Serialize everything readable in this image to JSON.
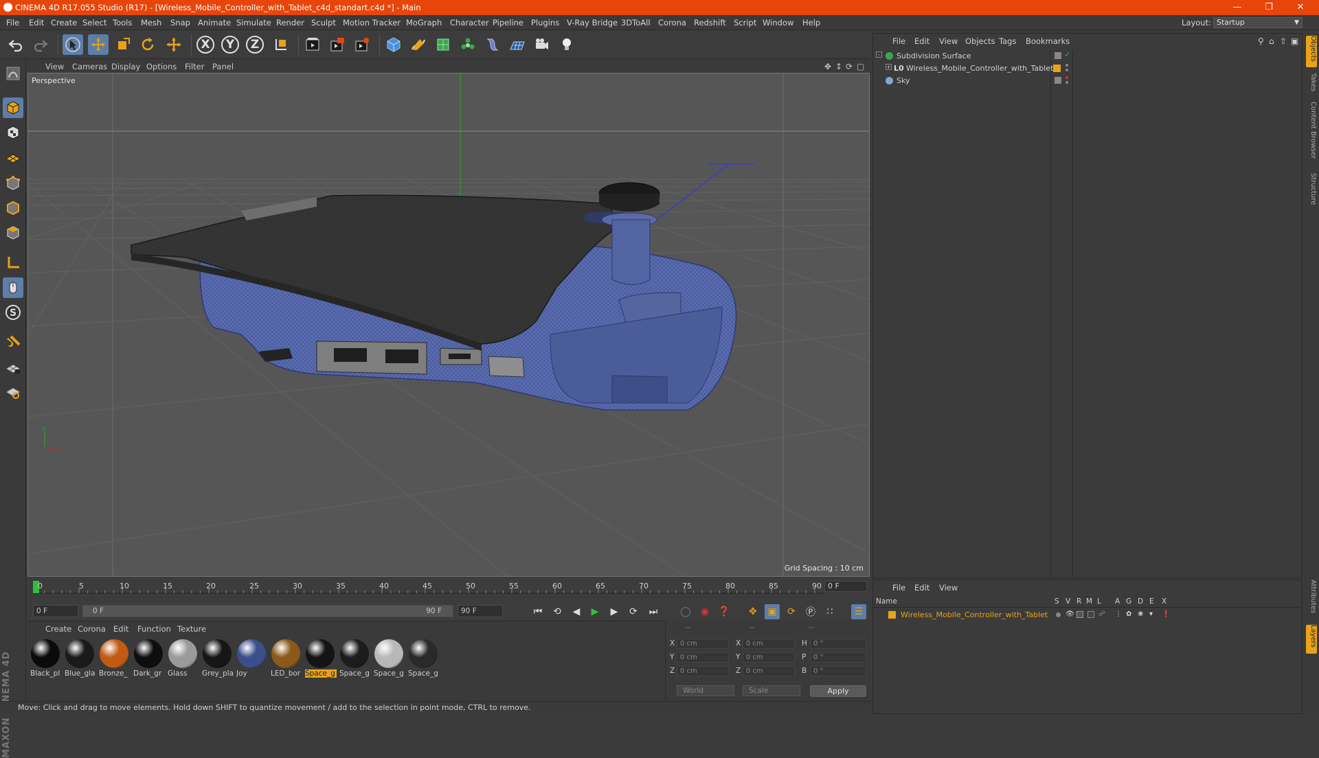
{
  "window": {
    "title": "CINEMA 4D R17.055 Studio (R17) - [Wireless_Mobile_Controller_with_Tablet_c4d_standart.c4d *] - Main",
    "controls": [
      "—",
      "❐",
      "✕"
    ]
  },
  "menu": [
    "File",
    "Edit",
    "Create",
    "Select",
    "Tools",
    "Mesh",
    "Snap",
    "Animate",
    "Simulate",
    "Render",
    "Sculpt",
    "Motion Tracker",
    "MoGraph",
    "Character",
    "Pipeline",
    "Plugins",
    "V-Ray Bridge",
    "3DToAll",
    "Corona",
    "Redshift",
    "Script",
    "Window",
    "Help"
  ],
  "layout": {
    "label": "Layout:",
    "value": "Startup"
  },
  "toolbar": {
    "axis_x": "X",
    "axis_y": "Y",
    "axis_z": "Z",
    "icons": [
      "undo-icon",
      "redo-icon",
      "select-arrow-icon",
      "move-icon",
      "scale-icon",
      "rotate-icon",
      "live-selection-icon",
      "coordinate-system-icon",
      "render-view-icon",
      "render-picture-viewer-icon",
      "edit-render-settings-icon",
      "cube-icon",
      "pen-icon",
      "subdivision-icon",
      "array-icon",
      "deformer-icon",
      "floor-icon",
      "camera-icon",
      "light-icon"
    ]
  },
  "viewport": {
    "menu": [
      "View",
      "Cameras",
      "Display",
      "Options",
      "Filter",
      "Panel"
    ],
    "label": "Perspective",
    "grid_spacing": "Grid Spacing : 10 cm"
  },
  "timeline": {
    "ticks": [
      "0",
      "5",
      "10",
      "15",
      "20",
      "25",
      "30",
      "35",
      "40",
      "45",
      "50",
      "55",
      "60",
      "65",
      "70",
      "75",
      "80",
      "85",
      "90"
    ],
    "current_frame": "0 F",
    "start_field": "0 F",
    "range_start": "0 F",
    "range_end": "90 F",
    "end_field": "90 F"
  },
  "materials": {
    "menu": [
      "Create",
      "Corona",
      "Edit",
      "Function",
      "Texture"
    ],
    "items": [
      {
        "name": "Black_pl",
        "color": "#0b0b0b"
      },
      {
        "name": "Blue_gla",
        "color": "#1a1a1a"
      },
      {
        "name": "Bronze_",
        "color": "#c25a12"
      },
      {
        "name": "Dark_gr",
        "color": "#0e0e0e"
      },
      {
        "name": "Glass",
        "color": "#9a9a9a"
      },
      {
        "name": "Grey_pla",
        "color": "#161616"
      },
      {
        "name": "Joy",
        "color": "#3a4f8c"
      },
      {
        "name": "LED_bor",
        "color": "#8a5a18"
      },
      {
        "name": "Space_g",
        "color": "#141414",
        "selected": true
      },
      {
        "name": "Space_g",
        "color": "#1c1c1c"
      },
      {
        "name": "Space_g",
        "color": "#b8b8b8"
      },
      {
        "name": "Space_g",
        "color": "#2a2a2a"
      }
    ]
  },
  "coordinates": {
    "headers": [
      "--",
      "--",
      "--"
    ],
    "rows": [
      {
        "a": "X",
        "av": "0 cm",
        "b": "X",
        "bv": "0 cm",
        "c": "H",
        "cv": "0 °"
      },
      {
        "a": "Y",
        "av": "0 cm",
        "b": "Y",
        "bv": "0 cm",
        "c": "P",
        "cv": "0 °"
      },
      {
        "a": "Z",
        "av": "0 cm",
        "b": "Z",
        "bv": "0 cm",
        "c": "B",
        "cv": "0 °"
      }
    ],
    "world": "World",
    "scale": "Scale",
    "apply": "Apply"
  },
  "status": "Move: Click and drag to move elements. Hold down SHIFT to quantize movement / add to the selection in point mode, CTRL to remove.",
  "object_manager": {
    "menu": [
      "File",
      "Edit",
      "View",
      "Objects",
      "Tags",
      "Bookmarks"
    ],
    "objects": [
      {
        "name": "Subdivision Surface"
      },
      {
        "name": "Wireless_Mobile_Controller_with_Tablet"
      },
      {
        "name": "Sky"
      }
    ]
  },
  "layer_manager": {
    "menu": [
      "File",
      "Edit",
      "View"
    ],
    "columns": [
      "Name",
      "S",
      "V",
      "R",
      "M",
      "L",
      "A",
      "G",
      "D",
      "E",
      "X"
    ],
    "layer": "Wireless_Mobile_Controller_with_Tablet",
    "layer_color": "#e8a317"
  },
  "side_tabs": [
    "Objects",
    "Takes",
    "Content Browser",
    "Structure",
    "Attributes",
    "Layers"
  ],
  "brand": "MAXON CINEMA 4D"
}
